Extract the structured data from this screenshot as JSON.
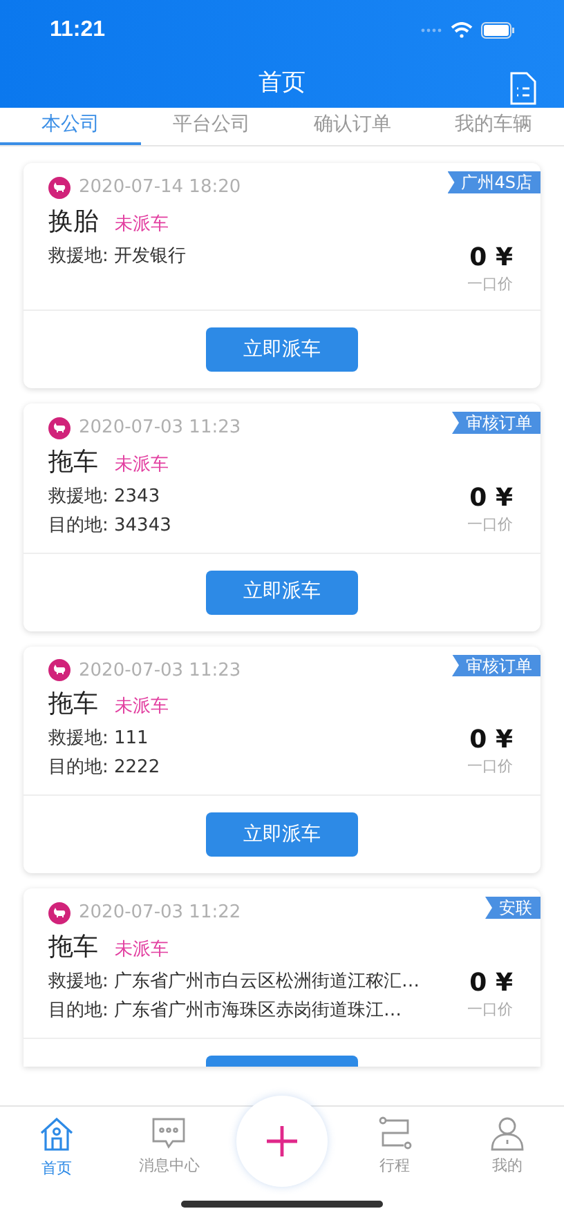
{
  "status_bar": {
    "time": "11:21"
  },
  "header": {
    "title": "首页"
  },
  "tabs": [
    {
      "label": "本公司",
      "selected": true
    },
    {
      "label": "平台公司",
      "selected": false
    },
    {
      "label": "确认订单",
      "selected": false
    },
    {
      "label": "我的车辆",
      "selected": false
    }
  ],
  "orders": [
    {
      "time": "2020-07-14 18:20",
      "tag": "广州4S店",
      "service": "换胎",
      "status": "未派车",
      "lines": [
        "救援地: 开发银行"
      ],
      "price": "0 ¥",
      "price_note": "一口价",
      "button": "立即派车"
    },
    {
      "time": "2020-07-03 11:23",
      "tag": "审核订单",
      "service": "拖车",
      "status": "未派车",
      "lines": [
        "救援地: 2343",
        "目的地: 34343"
      ],
      "price": "0 ¥",
      "price_note": "一口价",
      "button": "立即派车"
    },
    {
      "time": "2020-07-03 11:23",
      "tag": "审核订单",
      "service": "拖车",
      "status": "未派车",
      "lines": [
        "救援地: 111",
        "目的地: 2222"
      ],
      "price": "0 ¥",
      "price_note": "一口价",
      "button": "立即派车"
    },
    {
      "time": "2020-07-03 11:22",
      "tag": "安联",
      "service": "拖车",
      "status": "未派车",
      "lines": [
        "救援地: 广东省广州市白云区松洲街道江秾汇…",
        "目的地: 广东省广州市海珠区赤岗街道珠江…"
      ],
      "price": "0 ¥",
      "price_note": "一口价"
    }
  ],
  "bottom_nav": [
    {
      "kind": "home",
      "label": "首页",
      "selected": true
    },
    {
      "kind": "messages",
      "label": "消息中心",
      "selected": false
    },
    {
      "kind": "add",
      "selected": false
    },
    {
      "kind": "route",
      "label": "行程",
      "selected": false
    },
    {
      "kind": "profile",
      "label": "我的",
      "selected": false
    }
  ]
}
